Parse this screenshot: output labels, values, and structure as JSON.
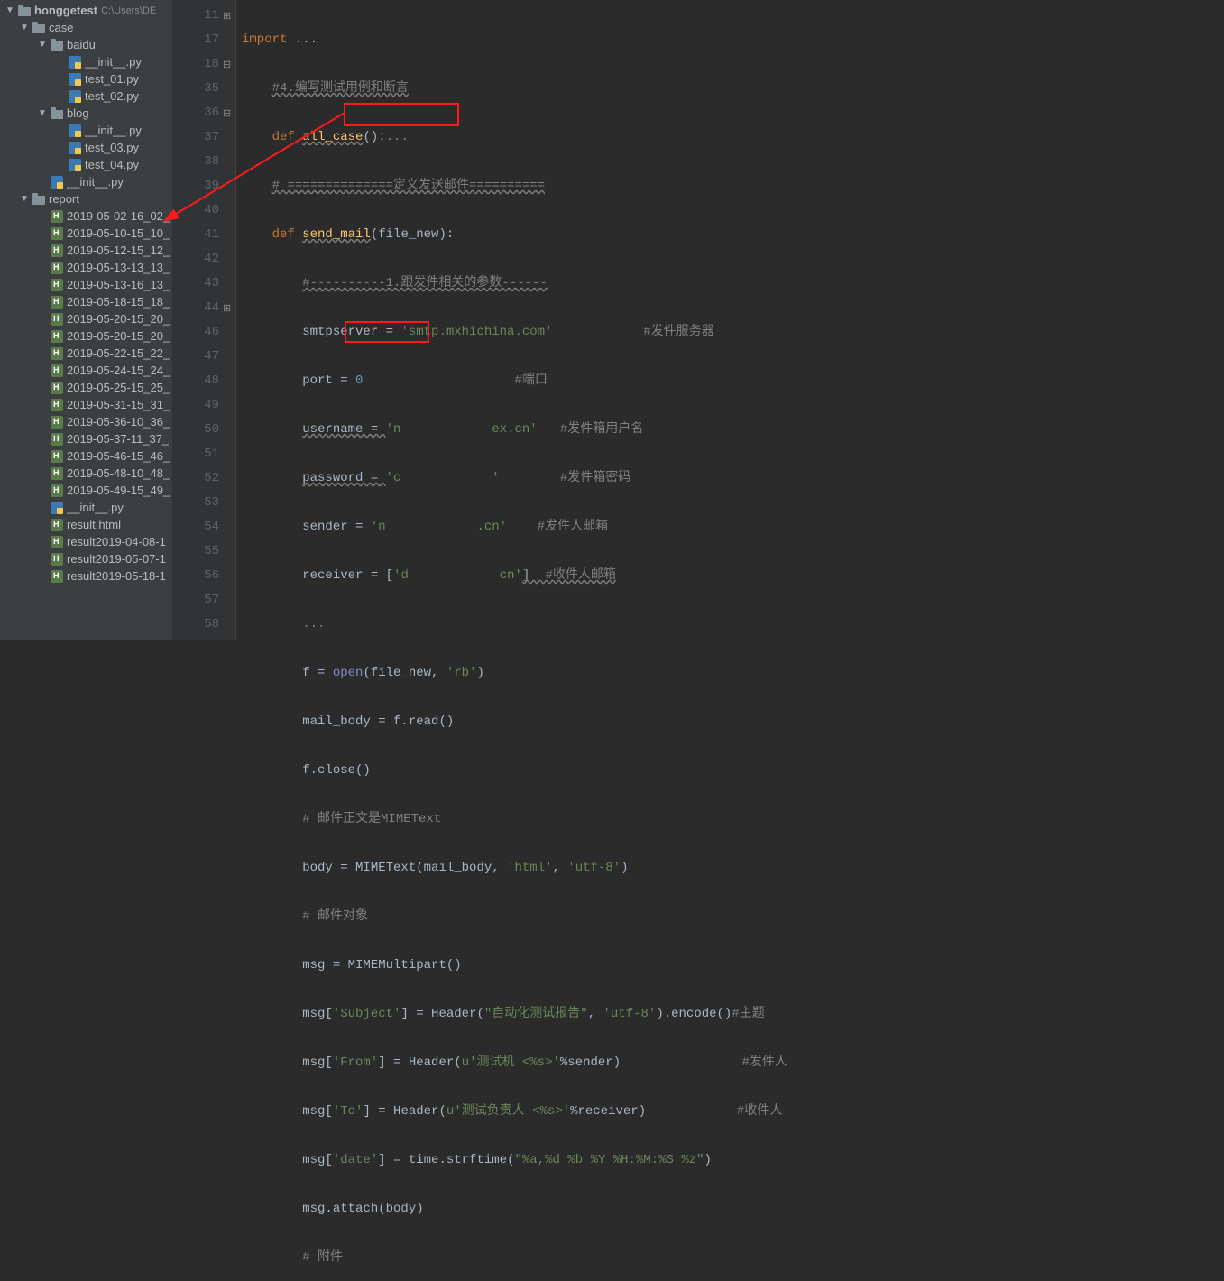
{
  "sidebar": {
    "root": "honggetest",
    "root_path": "C:\\Users\\DE",
    "folders": {
      "case": "case",
      "baidu": "baidu",
      "blog": "blog",
      "report": "report"
    },
    "files": {
      "baidu_init": "__init__.py",
      "test01": "test_01.py",
      "test02": "test_02.py",
      "blog_init": "__init__.py",
      "test03": "test_03.py",
      "test04": "test_04.py",
      "case_init": "__init__.py",
      "report_init": "__init__.py",
      "result_html": "result.html"
    },
    "reports": [
      "2019-05-02-16_02_",
      "2019-05-10-15_10_",
      "2019-05-12-15_12_",
      "2019-05-13-13_13_",
      "2019-05-13-16_13_",
      "2019-05-18-15_18_",
      "2019-05-20-15_20_",
      "2019-05-20-15_20_",
      "2019-05-22-15_22_",
      "2019-05-24-15_24_",
      "2019-05-25-15_25_",
      "2019-05-31-15_31_",
      "2019-05-36-10_36_",
      "2019-05-37-11_37_",
      "2019-05-46-15_46_",
      "2019-05-48-10_48_",
      "2019-05-49-15_49_"
    ],
    "results": [
      "result2019-04-08-1",
      "result2019-05-07-1",
      "result2019-05-18-1"
    ]
  },
  "gutter": [
    "11",
    "17",
    "18",
    "35",
    "36",
    "37",
    "38",
    "39",
    "40",
    "41",
    "42",
    "43",
    "44",
    "46",
    "47",
    "48",
    "49",
    "50",
    "51",
    "52",
    "53",
    "54",
    "55",
    "56",
    "57",
    "58"
  ],
  "code": {
    "l0_import": "import",
    "l0_dots": " ...",
    "l1": "#4.编写测试用例和断言",
    "l2_def": "def ",
    "l2_fn": "all_case",
    "l2_rest": "():",
    "l2_fold": "...",
    "l3": "# ==============定义发送邮件==========",
    "l4_def": "def ",
    "l4_fn": "send_mail",
    "l4_rest": "(file_new):",
    "l5": "#----------1.跟发件相关的参数------",
    "l6a": "smtpserver = ",
    "l6s": "'smtp.mxhichina.com'",
    "l6c": "            #发件服务器",
    "l7a": "port = ",
    "l7n": "0",
    "l7c": "                    #端口",
    "l8a": "username = ",
    "l8s": "'n            ex.cn'",
    "l8c": "   #发件箱用户名",
    "l9a": "password = ",
    "l9s": "'c            '",
    "l9c": "        #发件箱密码",
    "l10a": "sender = ",
    "l10s": "'n            .cn'",
    "l10c": "    #发件人邮箱",
    "l11a": "receiver = [",
    "l11s": "'d            cn'",
    "l11c": "]  #收件人邮箱",
    "l12": "...",
    "l13a": "f = ",
    "l13b": "open",
    "l13c": "(file_new, ",
    "l13s": "'rb'",
    "l13d": ")",
    "l14": "mail_body = f.read()",
    "l15": "f.close()",
    "l16": "# 邮件正文是MIMEText",
    "l17a": "body = MIMEText(mail_body, ",
    "l17s1": "'html'",
    "l17b": ", ",
    "l17s2": "'utf-8'",
    "l17c": ")",
    "l18": "# 邮件对象",
    "l19": "msg = MIMEMultipart()",
    "l20a": "msg[",
    "l20s1": "'Subject'",
    "l20b": "] = Header(",
    "l20s2": "\"自动化测试报告\"",
    "l20c": ", ",
    "l20s3": "'utf-8'",
    "l20d": ").encode()",
    "l20e": "#主题",
    "l21a": "msg[",
    "l21s1": "'From'",
    "l21b": "] = Header(",
    "l21u": "u",
    "l21s2": "'测试机 <%s>'",
    "l21c": "%sender)                ",
    "l21e": "#发件人",
    "l22a": "msg[",
    "l22s1": "'To'",
    "l22b": "] = Header(",
    "l22u": "u",
    "l22s2": "'测试负责人 <%s>'",
    "l22c": "%receiver)            ",
    "l22e": "#收件人",
    "l23a": "msg[",
    "l23s1": "'date'",
    "l23b": "] = time.strftime(",
    "l23s2": "\"%a,%d %b %Y %H:%M:%S %z\"",
    "l23c": ")",
    "l24": "msg.attach(body)",
    "l25": "# 附件"
  }
}
